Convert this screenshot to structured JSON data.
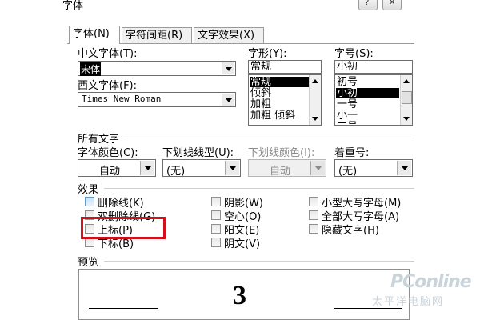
{
  "dialog": {
    "title": "字体"
  },
  "tabs": [
    {
      "label": "字体(N)",
      "active": true
    },
    {
      "label": "字符间距(R)",
      "active": false
    },
    {
      "label": "文字效果(X)",
      "active": false
    }
  ],
  "font": {
    "cn_label": "中文字体(T):",
    "cn_value": "宋体",
    "west_label": "西文字体(F):",
    "west_value": "Times New Roman",
    "style_label": "字形(Y):",
    "style_value": "常规",
    "style_items": [
      "常规",
      "倾斜",
      "加粗",
      "加粗 倾斜"
    ],
    "style_selected": 0,
    "size_label": "字号(S):",
    "size_value": "小初",
    "size_items": [
      "初号",
      "小初",
      "一号",
      "小一",
      "二号"
    ],
    "size_selected": 1
  },
  "all_text": {
    "heading": "所有文字",
    "color_label": "字体颜色(C):",
    "color_value": "自动",
    "underline_label": "下划线线型(U):",
    "underline_value": "(无)",
    "underline_color_label": "下划线颜色(I):",
    "underline_color_value": "自动",
    "emphasis_label": "着重号:",
    "emphasis_value": "(无)"
  },
  "effects": {
    "heading": "效果",
    "col1": [
      "删除线(K)",
      "双删除线(G)",
      "上标(P)",
      "下标(B)"
    ],
    "col2": [
      "阴影(W)",
      "空心(O)",
      "阳文(E)",
      "阴文(V)"
    ],
    "col3": [
      "小型大写字母(M)",
      "全部大写字母(A)",
      "隐藏文字(H)"
    ]
  },
  "preview": {
    "label": "预览",
    "sample": "3"
  },
  "watermark": {
    "brand": "PConline",
    "sub": "太平洋电脑网"
  },
  "colors": {
    "highlight": "#d4101a",
    "selection": "#000000"
  }
}
